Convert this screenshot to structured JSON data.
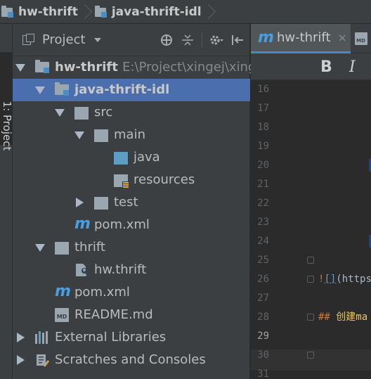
{
  "navbar": {
    "crumbs": [
      {
        "label": "hw-thrift"
      },
      {
        "label": "java-thrift-idl"
      }
    ]
  },
  "stripe": {
    "label": "1: Project"
  },
  "panel": {
    "title": "Project",
    "tools": [
      "crosshair-icon",
      "collapse-all-icon",
      "gear-icon",
      "hide-icon"
    ]
  },
  "tree": [
    {
      "label": "hw-thrift",
      "extra": "E:\\Project\\xingej\\xinge",
      "icon": "module-icon",
      "expanded": true,
      "bold": true
    },
    {
      "label": "java-thrift-idl",
      "icon": "module-icon",
      "expanded": true,
      "bold": true,
      "selected": true
    },
    {
      "label": "src",
      "icon": "folder-icon",
      "expanded": true
    },
    {
      "label": "main",
      "icon": "folder-icon",
      "expanded": true
    },
    {
      "label": "java",
      "icon": "source-folder-icon"
    },
    {
      "label": "resources",
      "icon": "resources-folder-icon"
    },
    {
      "label": "test",
      "icon": "folder-icon",
      "expanded": false
    },
    {
      "label": "pom.xml",
      "icon": "maven-icon"
    },
    {
      "label": "thrift",
      "icon": "folder-icon",
      "expanded": true
    },
    {
      "label": "hw.thrift",
      "icon": "thrift-file-icon"
    },
    {
      "label": "pom.xml",
      "icon": "maven-icon"
    },
    {
      "label": "README.md",
      "icon": "markdown-icon"
    },
    {
      "label": "External Libraries",
      "icon": "library-icon",
      "expanded": false
    },
    {
      "label": "Scratches and Consoles",
      "icon": "scratch-icon",
      "expanded": false
    }
  ],
  "editor": {
    "tabs": [
      {
        "label": "hw-thrift",
        "icon": "maven-icon",
        "close": "×",
        "active": true
      },
      {
        "label": "",
        "icon": "markdown-icon",
        "active": false
      }
    ],
    "toolbar": {
      "bold": "B",
      "italic": "I"
    },
    "line_numbers": [
      "16",
      "17",
      "18",
      "19",
      "20",
      "21",
      "22",
      "23",
      "24",
      "25",
      "26",
      "27",
      "28",
      "29",
      "30",
      "31"
    ],
    "current_line": "29",
    "code": {
      "line26_bang": "!",
      "line26_brackets": "[]",
      "line26_rest": "(https",
      "line28_hash": "## ",
      "line28_text": "创建ma"
    }
  },
  "colors": {
    "selection": "#4b6eaf",
    "maven_accent": "#4a9fe3",
    "source_folder": "#5d9ec7"
  }
}
